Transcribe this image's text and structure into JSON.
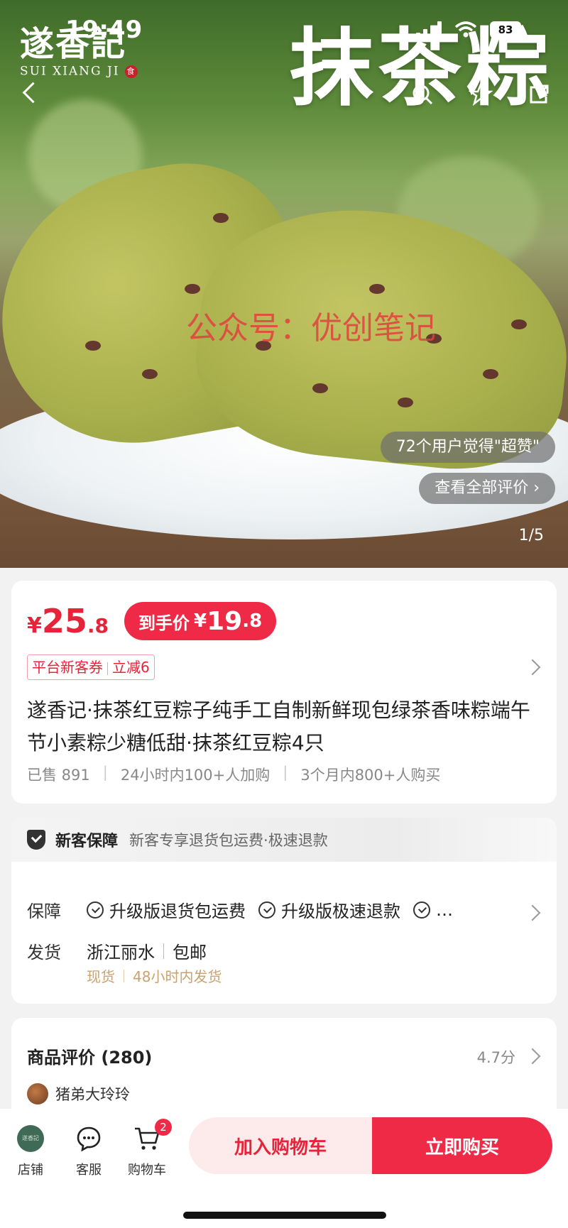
{
  "status_bar": {
    "time": "19:49",
    "battery": "83"
  },
  "hero": {
    "brand_cn": "遂香記",
    "brand_en": "SUI XIANG JI",
    "brand_seal": "食",
    "title": "抹茶粽",
    "watermark": "公众号：优创笔记",
    "liked_pill": "72个用户觉得\"超赞\"",
    "all_reviews_pill": "查看全部评价 ›",
    "image_counter": "1/5"
  },
  "price": {
    "currency": "¥",
    "integer": "25",
    "decimal": ".8",
    "deal_label": "到手价",
    "deal_currency": "¥",
    "deal_integer": "19",
    "deal_decimal": ".8"
  },
  "coupon": {
    "left": "平台新客券",
    "right": "立减6"
  },
  "product": {
    "title": "遂香记·抹茶红豆粽子纯手工自制新鲜现包绿茶香味粽端午节小素粽少糖低甜·抹茶红豆粽4只",
    "sales": [
      "已售 891",
      "24小时内100+人加购",
      "3个月内800+人购买"
    ]
  },
  "guarantee": {
    "head_title": "新客保障",
    "head_desc": "新客专享退货包运费·极速退款",
    "row1_label": "保障",
    "row1_items": [
      "升级版退货包运费",
      "升级版极速退款",
      "…"
    ],
    "row2_label": "发货",
    "origin": "浙江丽水",
    "shipping": "包邮",
    "stock": "现货",
    "ship_time": "48小时内发货"
  },
  "reviews": {
    "title": "商品评价 (280)",
    "score": "4.7分",
    "first_user": "猪弟大玲玲"
  },
  "bottom_bar": {
    "store": "店铺",
    "store_logo": "遂香記",
    "service": "客服",
    "cart": "购物车",
    "cart_badge": "2",
    "add_to_cart": "加入购物车",
    "buy_now": "立即购买"
  },
  "colors": {
    "accent": "#EF2A47",
    "price": "#E7233A",
    "gold": "#C9A26E"
  }
}
